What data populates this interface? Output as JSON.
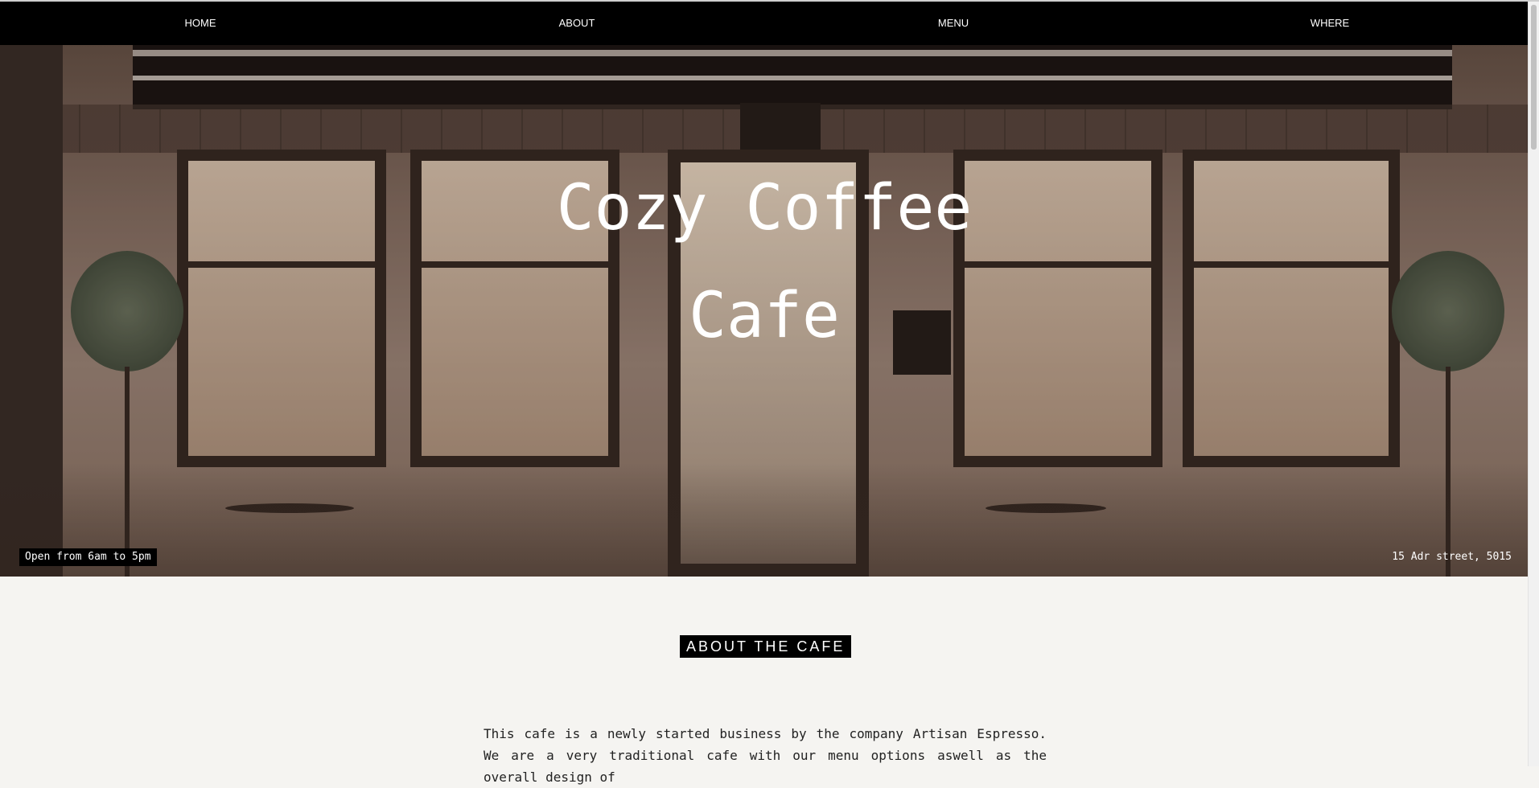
{
  "nav": {
    "items": [
      {
        "label": "HOME"
      },
      {
        "label": "ABOUT"
      },
      {
        "label": "MENU"
      },
      {
        "label": "WHERE"
      }
    ]
  },
  "hero": {
    "title_line1": "Cozy Coffee",
    "title_line2": "Cafe",
    "hours": "Open from 6am to 5pm",
    "address": "15 Adr street, 5015"
  },
  "about": {
    "heading": "ABOUT THE CAFE",
    "text": "This cafe is a newly started business by the company Artisan Espresso. We are a very traditional cafe with our menu options aswell as the overall design of"
  },
  "colors": {
    "nav_bg": "#000000",
    "page_bg": "#f5f4f1",
    "text_light": "#ffffff"
  }
}
